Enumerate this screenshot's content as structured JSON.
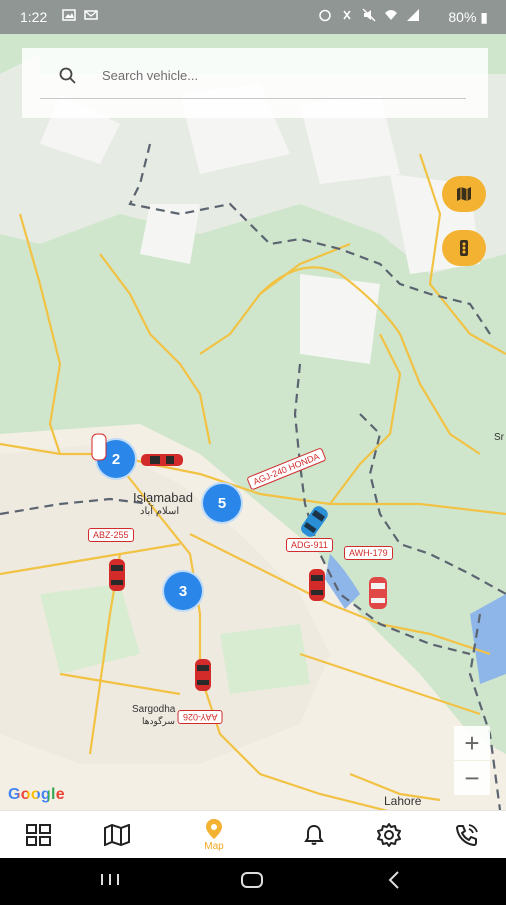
{
  "status_bar": {
    "time": "1:22",
    "battery": "80%"
  },
  "search": {
    "placeholder": "Search vehicle..."
  },
  "map": {
    "clusters": [
      "2",
      "5",
      "3"
    ],
    "vehicles": [
      {
        "plate": "AGJ-240 HONDA",
        "color": "#2b8fd6"
      },
      {
        "plate": "ABZ-255",
        "color": "#d32a2a"
      },
      {
        "plate": "ADG-911",
        "color": "#d32a2a"
      },
      {
        "plate": "AWH-179",
        "color": "#d32a2a"
      },
      {
        "plate": "AAY-026",
        "color": "#d32a2a"
      }
    ],
    "places": {
      "islamabad": "Islamabad",
      "islamabad_urdu": "اسلام آباد",
      "sargodha": "Sargodha",
      "sargodha_urdu": "سرگودھا",
      "lahore": "Lahore",
      "edge": "Sr"
    },
    "zoom_in": "+",
    "zoom_out": "−",
    "attribution": "Google"
  },
  "bottom_nav": [
    {
      "label": ""
    },
    {
      "label": ""
    },
    {
      "label": "Map",
      "active": true
    },
    {
      "label": ""
    },
    {
      "label": ""
    },
    {
      "label": ""
    }
  ],
  "colors": {
    "accent": "#f4b233",
    "cluster": "#2a86e8",
    "vehicle_red": "#d32a2a"
  }
}
